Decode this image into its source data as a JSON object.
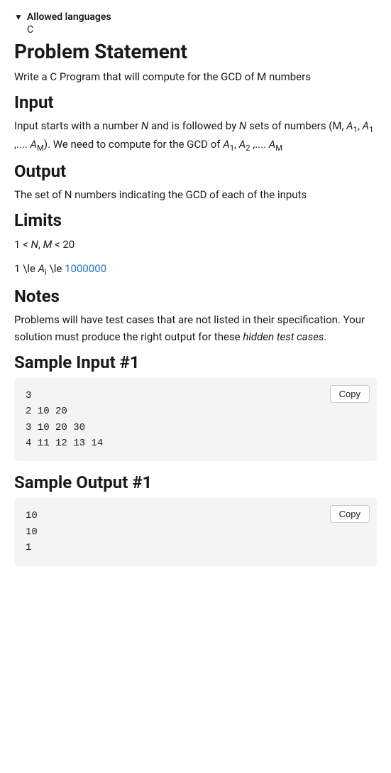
{
  "allowed_languages": {
    "header_label": "Allowed languages",
    "language": "C"
  },
  "problem_statement": {
    "title": "Problem Statement",
    "description": "Write a C Program that will compute for the GCD of M numbers"
  },
  "input_section": {
    "title": "Input",
    "description_parts": [
      "Input starts with a number ",
      "N",
      " and is followed by ",
      "N",
      " sets of numbers (M, A",
      "1",
      ", A",
      "1",
      " ,....",
      "A",
      "M",
      "). We need to compute for the GCD of A",
      "1",
      ", A",
      "2",
      " ,....A",
      "M"
    ]
  },
  "output_section": {
    "title": "Output",
    "description": "The set of N numbers indicating the GCD of each of the inputs"
  },
  "limits_section": {
    "title": "Limits",
    "limit1": "1 < N, M < 20",
    "limit2_prefix": "1 \\le A",
    "limit2_sub": "i",
    "limit2_middle": " \\le ",
    "limit2_number": "1000000",
    "limit2_display": "1 \\le A"
  },
  "notes_section": {
    "title": "Notes",
    "description": "Problems will have test cases that are not listed in their specification. Your solution must produce the right output for these ",
    "italic_text": "hidden test cases",
    "end_text": "."
  },
  "sample_input": {
    "title": "Sample Input #1",
    "copy_label": "Copy",
    "code": "3\n2 10 20\n3 10 20 30\n4 11 12 13 14"
  },
  "sample_output": {
    "title": "Sample Output #1",
    "copy_label": "Copy",
    "code": "10\n10\n1"
  }
}
